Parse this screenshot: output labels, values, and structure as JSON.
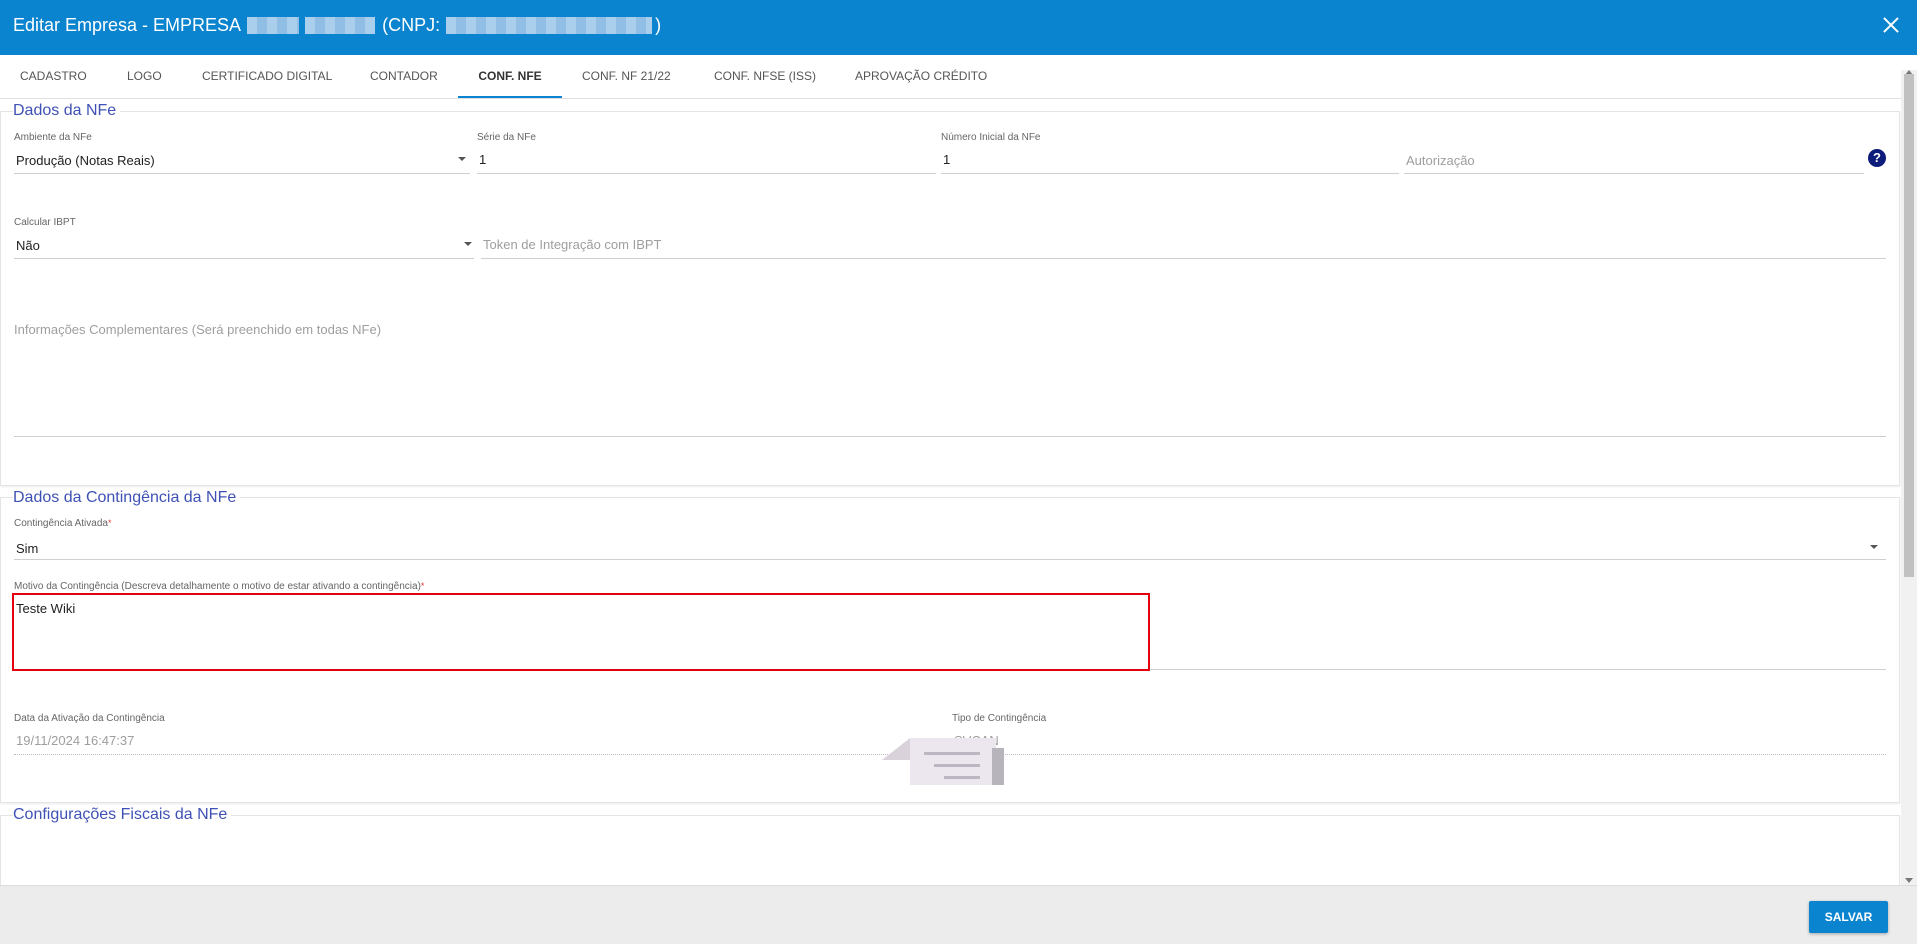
{
  "window": {
    "title_prefix": "Editar Empresa - EMPRESA",
    "title_cnpj_open": "(CNPJ:",
    "title_cnpj_close": ")"
  },
  "tabs": [
    {
      "label": "CADASTRO"
    },
    {
      "label": "LOGO"
    },
    {
      "label": "CERTIFICADO DIGITAL"
    },
    {
      "label": "CONTADOR"
    },
    {
      "label": "CONF. NFE",
      "active": true
    },
    {
      "label": "CONF. NF 21/22"
    },
    {
      "label": "CONF. NFSE (ISS)"
    },
    {
      "label": "APROVAÇÃO CRÉDITO"
    }
  ],
  "nfe": {
    "section_title": "Dados da NFe",
    "ambiente": {
      "label": "Ambiente da NFe",
      "value": "Produção (Notas Reais)"
    },
    "serie": {
      "label": "Série da NFe",
      "value": "1"
    },
    "numero_inicial": {
      "label": "Número Inicial da NFe",
      "value": "1"
    },
    "autorizacao": {
      "placeholder": "Autorização"
    },
    "calcular_ibpt": {
      "label": "Calcular IBPT",
      "value": "Não"
    },
    "token_ibpt": {
      "placeholder": "Token de Integração com IBPT"
    },
    "info_complementares": {
      "placeholder": "Informações Complementares (Será preenchido em todas NFe)"
    }
  },
  "contingencia": {
    "section_title": "Dados da Contingência da NFe",
    "ativada": {
      "label": "Contingência Ativada",
      "value": "Sim"
    },
    "motivo": {
      "label": "Motivo da Contingência (Descreva detalhamente o motivo de estar ativando a contingência)",
      "value": "Teste Wiki"
    },
    "data_ativacao": {
      "label": "Data da Ativação da Contingência",
      "value": "19/11/2024 16:47:37"
    },
    "tipo": {
      "label": "Tipo de Contingência",
      "value": "SVCAN"
    },
    "required_mark": "*"
  },
  "fiscais": {
    "section_title": "Configurações Fiscais da NFe"
  },
  "footer": {
    "save_label": "SALVAR"
  },
  "help_glyph": "?",
  "colors": {
    "header_bg": "#0b84cf",
    "section_title": "#3f51b5",
    "highlight_border": "#e3000f",
    "help_bg": "#0d1b7a"
  }
}
